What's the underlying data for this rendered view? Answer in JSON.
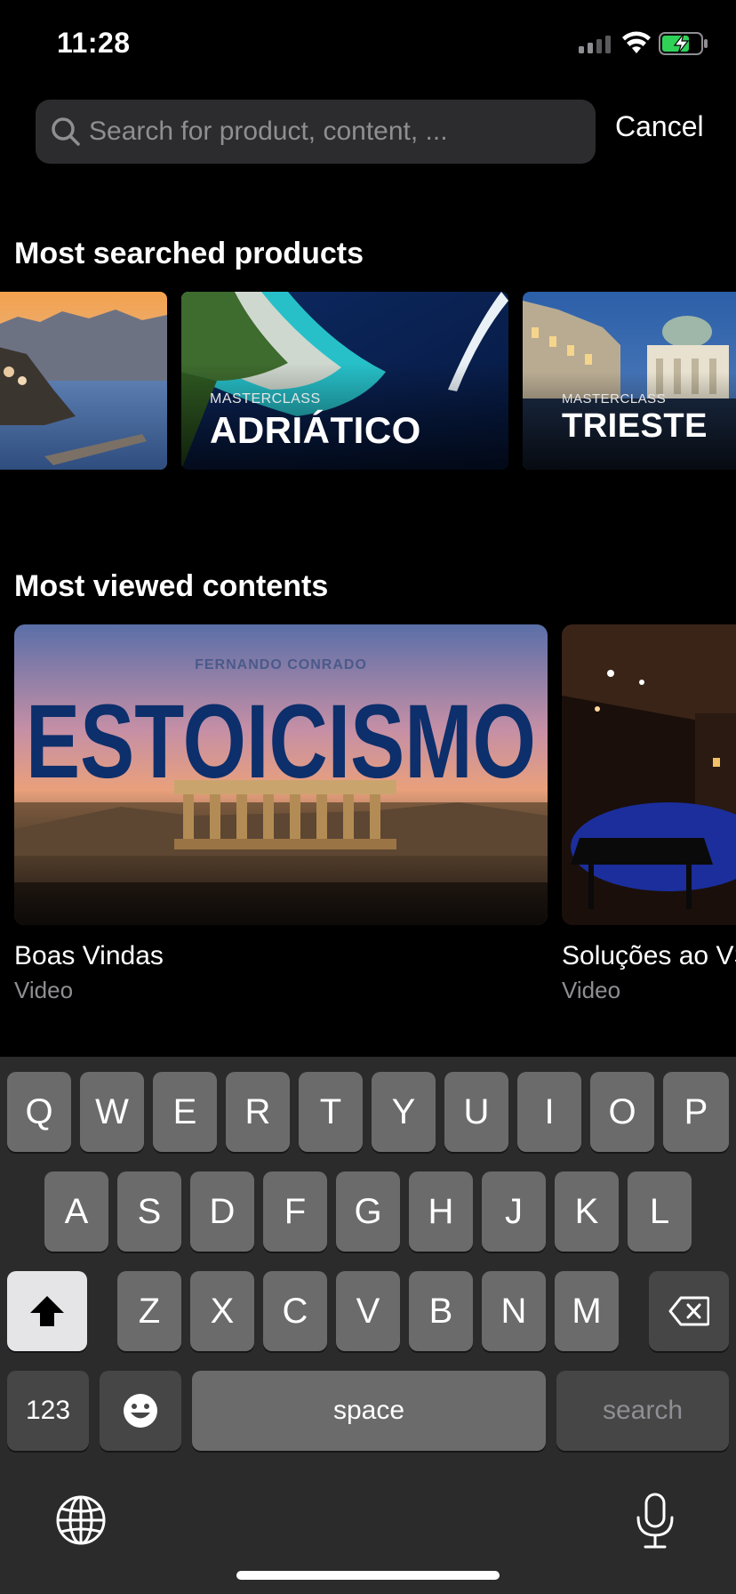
{
  "status": {
    "time": "11:28"
  },
  "search": {
    "placeholder": "Search for product, content, ...",
    "value": "",
    "cancel_label": "Cancel"
  },
  "sections": {
    "products_title": "Most searched products",
    "contents_title": "Most viewed contents"
  },
  "products": [
    {
      "kicker": "",
      "name": ""
    },
    {
      "kicker": "MASTERCLASS",
      "name": "ADRIÁTICO"
    },
    {
      "kicker": "MASTERCLASS",
      "name": "TRIESTE"
    }
  ],
  "contents": [
    {
      "title": "Boas Vindas",
      "type": "Video",
      "image_author": "FERNANDO CONRADO",
      "image_title": "ESTOICISMO"
    },
    {
      "title": "Soluções ao VS",
      "type": "Video"
    }
  ],
  "keyboard": {
    "row1": [
      "Q",
      "W",
      "E",
      "R",
      "T",
      "Y",
      "U",
      "I",
      "O",
      "P"
    ],
    "row2": [
      "A",
      "S",
      "D",
      "F",
      "G",
      "H",
      "J",
      "K",
      "L"
    ],
    "row3": [
      "Z",
      "X",
      "C",
      "V",
      "B",
      "N",
      "M"
    ],
    "numbers_label": "123",
    "space_label": "space",
    "search_label": "search"
  },
  "icons": {
    "search": "magnifier-icon",
    "shift": "shift-arrow-icon",
    "delete": "backspace-icon",
    "emoji": "smiley-icon",
    "globe": "globe-icon",
    "mic": "microphone-icon"
  },
  "colors": {
    "battery_charge": "#30d158",
    "search_field_bg": "#2c2c2e",
    "key": "#6b6b6b",
    "key_dark": "#464646"
  }
}
